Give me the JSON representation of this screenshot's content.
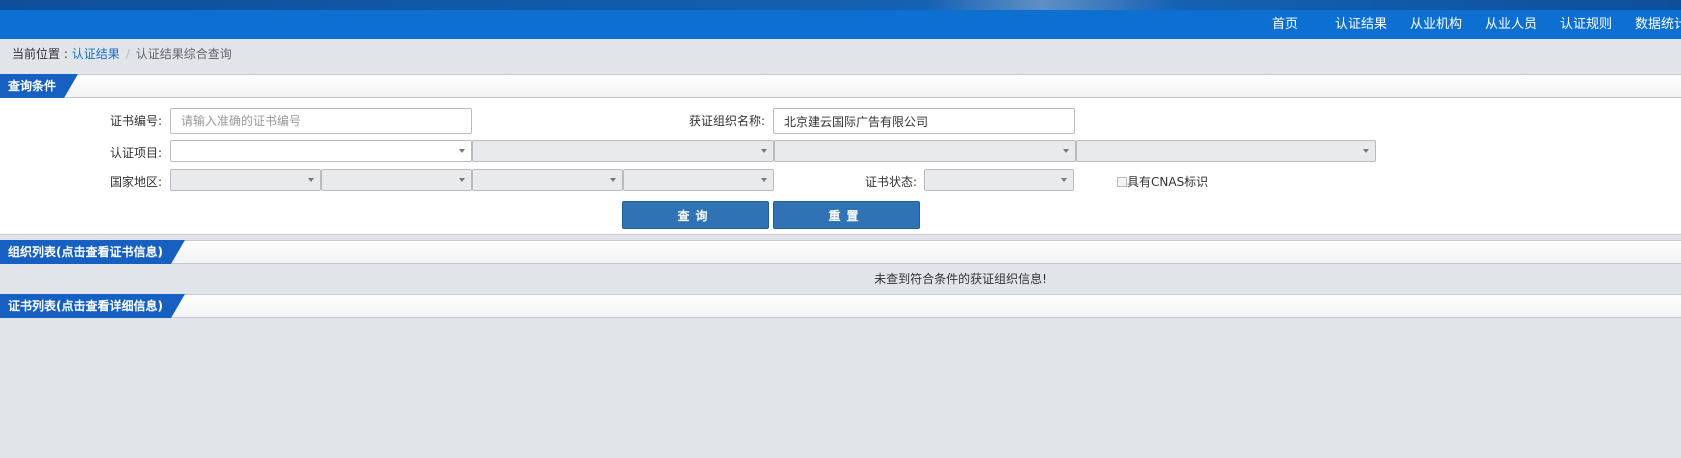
{
  "nav": {
    "items": [
      "首页",
      "认证结果",
      "从业机构",
      "从业人员",
      "认证规则",
      "数据统计"
    ]
  },
  "breadcrumb": {
    "prefix": "当前位置 : ",
    "link": "认证结果",
    "separator": "/",
    "current": "认证结果综合查询"
  },
  "query_panel": {
    "title": "查询条件",
    "cert_no_label": "证书编号:",
    "cert_no_placeholder": "请输入准确的证书编号",
    "org_name_label": "获证组织名称:",
    "org_name_value": "北京建云国际广告有限公司",
    "cert_item_label": "认证项目:",
    "region_label": "国家地区:",
    "cert_status_label": "证书状态:",
    "cnas_label": "具有CNAS标识",
    "cnas_checked": false,
    "search_button": "查询",
    "reset_button": "重置"
  },
  "org_panel": {
    "title": "组织列表(点击查看证书信息)",
    "empty_message": "未查到符合条件的获证组织信息!"
  },
  "cert_panel": {
    "title": "证书列表(点击查看详细信息)"
  },
  "colors": {
    "nav_bg": "#0d6fd2",
    "tab_bg": "#1560c0",
    "button_bg": "#2f73b5",
    "page_bg": "#e1e5ea"
  }
}
